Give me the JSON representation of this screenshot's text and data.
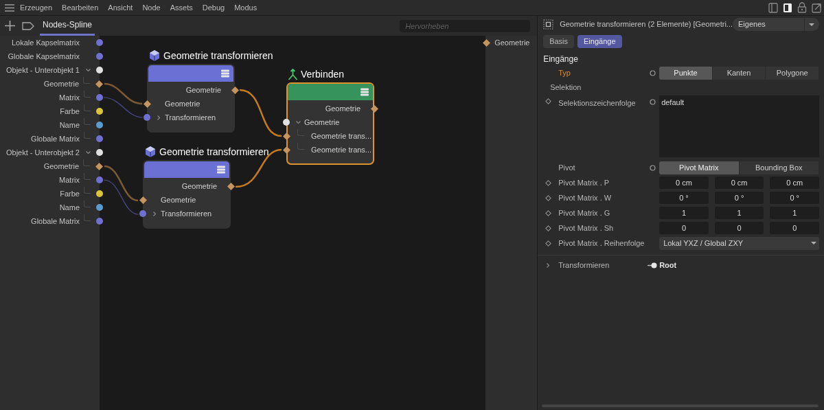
{
  "menu": [
    "Erzeugen",
    "Bearbeiten",
    "Ansicht",
    "Node",
    "Assets",
    "Debug",
    "Modus"
  ],
  "editor": {
    "tabs": [
      {
        "label": "Nodes-Spline",
        "selected": true
      }
    ],
    "search": {
      "placeholder": "Hervorheben"
    },
    "inputs": [
      {
        "label": "Lokale Kapselmatrix",
        "kind": "dot",
        "color": "#7070d0"
      },
      {
        "label": "Globale Kapselmatrix",
        "kind": "dot",
        "color": "#7070d0"
      },
      {
        "label": "Objekt - Unterobjekt 1",
        "kind": "dot",
        "color": "#e0e0e0",
        "expanded": true,
        "children": [
          {
            "label": "Geometrie",
            "kind": "diamond",
            "color": "#c4955f"
          },
          {
            "label": "Matrix",
            "kind": "dot",
            "color": "#7070d0"
          },
          {
            "label": "Farbe",
            "kind": "dot",
            "color": "#d9c43c"
          },
          {
            "label": "Name",
            "kind": "dot",
            "color": "#5a9bd0"
          },
          {
            "label": "Globale Matrix",
            "kind": "dot",
            "color": "#7070d0"
          }
        ]
      },
      {
        "label": "Objekt - Unterobjekt 2",
        "kind": "dot",
        "color": "#e0e0e0",
        "expanded": true,
        "children": [
          {
            "label": "Geometrie",
            "kind": "diamond",
            "color": "#c4955f"
          },
          {
            "label": "Matrix",
            "kind": "dot",
            "color": "#7070d0"
          },
          {
            "label": "Farbe",
            "kind": "dot",
            "color": "#d9c43c"
          },
          {
            "label": "Name",
            "kind": "dot",
            "color": "#5a9bd0"
          },
          {
            "label": "Globale Matrix",
            "kind": "dot",
            "color": "#7070d0"
          }
        ]
      }
    ],
    "nodes": [
      {
        "title": "Geometrie transformieren",
        "color": "#6b70d4",
        "selected": false,
        "outputs": [
          {
            "label": "Geometrie",
            "kind": "diamond",
            "color": "#c4955f"
          }
        ],
        "inputs": [
          {
            "label": "Geometrie",
            "kind": "diamond",
            "color": "#c4955f"
          },
          {
            "label": "Transformieren",
            "kind": "dot",
            "color": "#7070d0",
            "expanded": false
          }
        ]
      },
      {
        "title": "Geometrie transformieren",
        "color": "#6b70d4",
        "selected": false,
        "outputs": [
          {
            "label": "Geometrie",
            "kind": "diamond",
            "color": "#c4955f"
          }
        ],
        "inputs": [
          {
            "label": "Geometrie",
            "kind": "diamond",
            "color": "#c4955f"
          },
          {
            "label": "Transformieren",
            "kind": "dot",
            "color": "#7070d0",
            "expanded": false
          }
        ]
      },
      {
        "title": "Verbinden",
        "color": "#35935b",
        "selected": true,
        "outputs": [
          {
            "label": "Geometrie",
            "kind": "diamond",
            "color": "#c4955f"
          }
        ],
        "inputs": [
          {
            "label": "Geometrie",
            "kind": "dot",
            "color": "#e0e0e0",
            "expanded": true,
            "children": [
              {
                "label": "Geometrie trans...",
                "kind": "diamond",
                "color": "#c4955f"
              },
              {
                "label": "Geometrie trans...",
                "kind": "diamond",
                "color": "#c4955f"
              }
            ]
          }
        ]
      }
    ],
    "outputs": [
      {
        "label": "Geometrie",
        "kind": "diamond",
        "color": "#c4955f"
      }
    ]
  },
  "inspector": {
    "title": "Geometrie transformieren (2 Elemente) [Geometri...",
    "preset": "Eigenes",
    "tabs": [
      {
        "label": "Basis",
        "selected": false
      },
      {
        "label": "Eingänge",
        "selected": true
      }
    ],
    "section": "Eingänge",
    "rows": [
      {
        "kind": "segmented",
        "label": "Typ",
        "highlighted": true,
        "animatable": false,
        "options": [
          {
            "label": "Punkte",
            "selected": true
          },
          {
            "label": "Kanten",
            "selected": false
          },
          {
            "label": "Polygone",
            "selected": false
          }
        ]
      },
      {
        "kind": "group",
        "label": "Selektion",
        "highlighted": false
      },
      {
        "kind": "text",
        "label": "Selektionszeichenfolge",
        "highlighted": false,
        "animatable": true,
        "value": "default"
      },
      {
        "kind": "segmented",
        "label": "Pivot",
        "highlighted": false,
        "animatable": false,
        "options": [
          {
            "label": "Pivot Matrix",
            "selected": true
          },
          {
            "label": "Bounding Box",
            "selected": false
          }
        ]
      },
      {
        "kind": "vector",
        "label": "Pivot Matrix . P",
        "highlighted": false,
        "animatable": true,
        "values": [
          "0 cm",
          "0 cm",
          "0 cm"
        ]
      },
      {
        "kind": "vector",
        "label": "Pivot Matrix . W",
        "highlighted": false,
        "animatable": true,
        "values": [
          "0 °",
          "0 °",
          "0 °"
        ]
      },
      {
        "kind": "vector",
        "label": "Pivot Matrix . G",
        "highlighted": false,
        "animatable": true,
        "values": [
          "1",
          "1",
          "1"
        ]
      },
      {
        "kind": "vector",
        "label": "Pivot Matrix . Sh",
        "highlighted": false,
        "animatable": true,
        "values": [
          "0",
          "0",
          "0"
        ]
      },
      {
        "kind": "dropdown",
        "label": "Pivot Matrix . Reihenfolge",
        "highlighted": false,
        "animatable": true,
        "value": "Lokal YXZ / Global ZXY"
      },
      {
        "kind": "link",
        "label": "Transformieren",
        "highlighted": false,
        "animatable": false,
        "expanded": false,
        "value": "Root"
      }
    ]
  }
}
